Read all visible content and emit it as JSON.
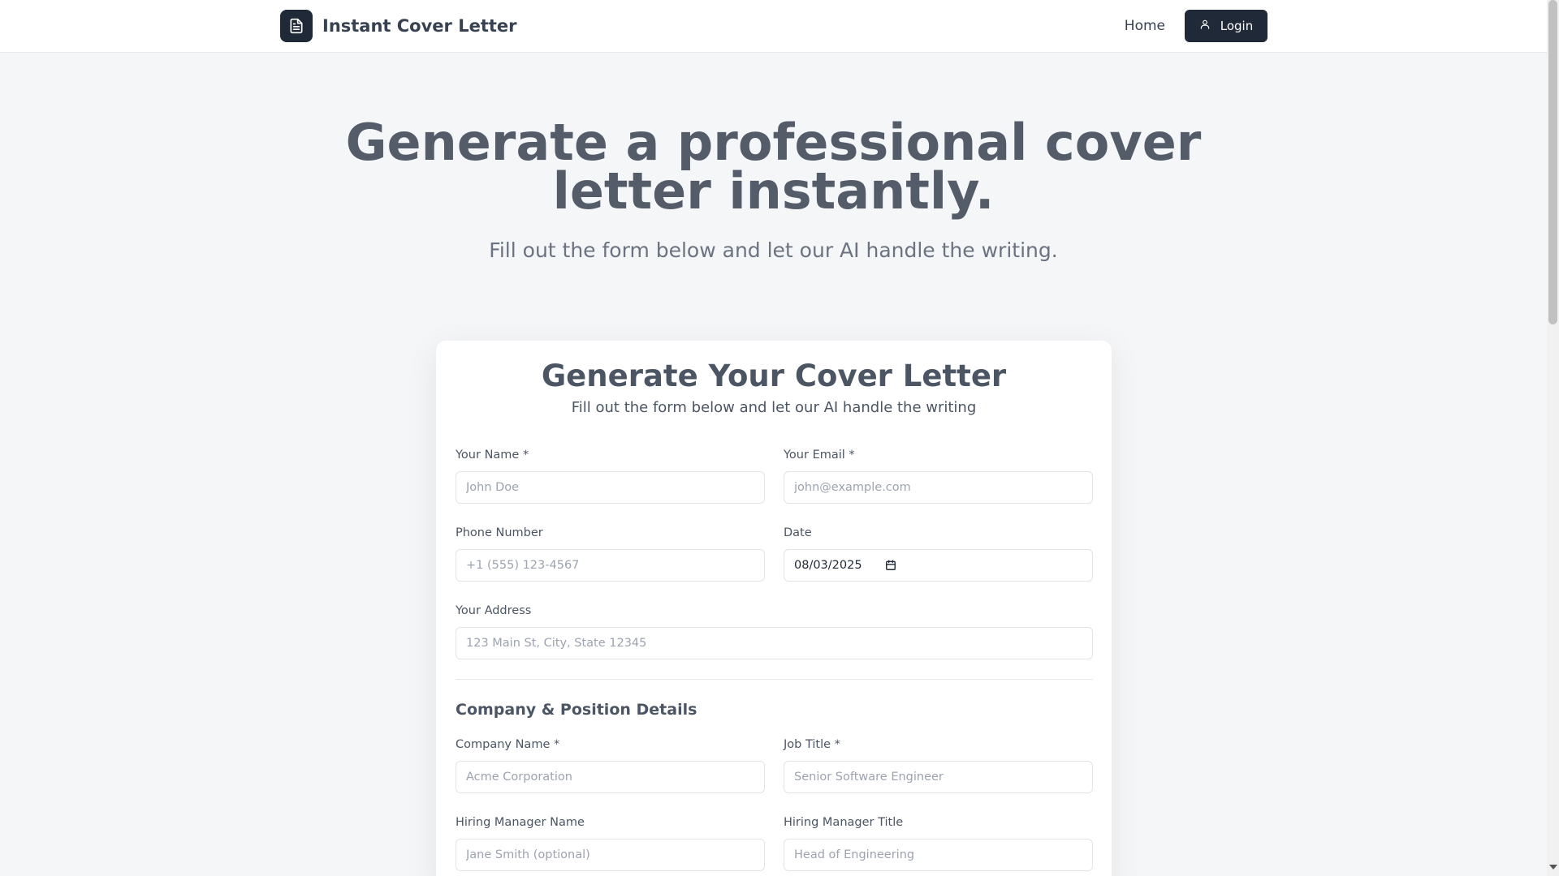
{
  "header": {
    "brand_name": "Instant Cover Letter",
    "nav_home": "Home",
    "login_label": "Login"
  },
  "hero": {
    "title_line1": "Generate a professional cover",
    "title_line2": "letter instantly.",
    "subtitle": "Fill out the form below and let our AI handle the writing."
  },
  "form": {
    "title": "Generate Your Cover Letter",
    "subtitle": "Fill out the form below and let our AI handle the writing",
    "name_label": "Your Name *",
    "name_placeholder": "John Doe",
    "email_label": "Your Email *",
    "email_placeholder": "john@example.com",
    "phone_label": "Phone Number",
    "phone_placeholder": "+1 (555) 123-4567",
    "date_label": "Date",
    "date_value": "08/03/2025",
    "address_label": "Your Address",
    "address_placeholder": "123 Main St, City, State 12345",
    "section_company": "Company & Position Details",
    "company_label": "Company Name *",
    "company_placeholder": "Acme Corporation",
    "job_label": "Job Title *",
    "job_placeholder": "Senior Software Engineer",
    "manager_name_label": "Hiring Manager Name",
    "manager_name_placeholder": "Jane Smith (optional)",
    "manager_title_label": "Hiring Manager Title",
    "manager_title_placeholder": "Head of Engineering"
  },
  "colors": {
    "primary_dark": "#1f2937",
    "text": "#4b5563",
    "muted": "#6b7280",
    "background": "#f5f6f8"
  },
  "icons": {
    "brand": "document-icon",
    "login": "user-icon",
    "date": "calendar-icon"
  }
}
